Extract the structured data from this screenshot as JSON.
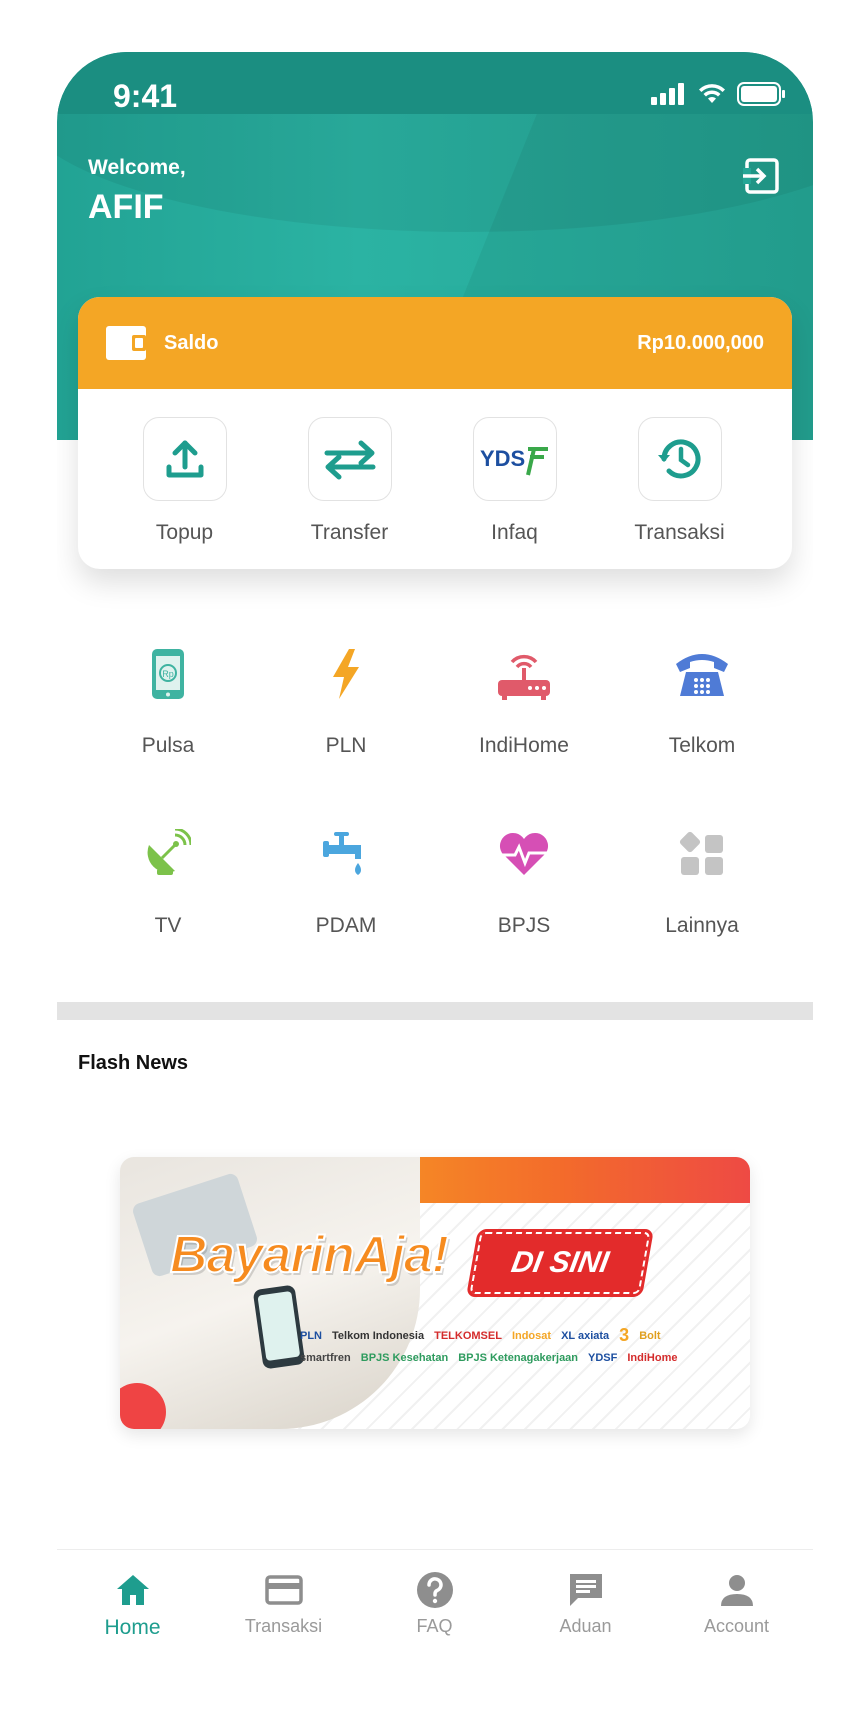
{
  "status_bar": {
    "time": "9:41"
  },
  "header": {
    "welcome": "Welcome,",
    "username": "AFIF"
  },
  "wallet": {
    "label": "Saldo",
    "amount": "Rp10.000,000"
  },
  "quick_actions": [
    {
      "label": "Topup",
      "icon": "upload-icon"
    },
    {
      "label": "Transfer",
      "icon": "transfer-arrows-icon"
    },
    {
      "label": "Infaq",
      "icon": "ydsf-logo-icon"
    },
    {
      "label": "Transaksi",
      "icon": "history-icon"
    }
  ],
  "services": [
    {
      "label": "Pulsa",
      "icon": "phone-rp-icon",
      "color": "#3fb3a1"
    },
    {
      "label": "PLN",
      "icon": "lightning-icon",
      "color": "#f4a625"
    },
    {
      "label": "IndiHome",
      "icon": "router-icon",
      "color": "#e05a6a"
    },
    {
      "label": "Telkom",
      "icon": "telephone-icon",
      "color": "#4f7bd6"
    },
    {
      "label": "TV",
      "icon": "satellite-dish-icon",
      "color": "#7cc24a"
    },
    {
      "label": "PDAM",
      "icon": "water-tap-icon",
      "color": "#4ba6de"
    },
    {
      "label": "BPJS",
      "icon": "heart-pulse-icon",
      "color": "#d64fb5"
    },
    {
      "label": "Lainnya",
      "icon": "grid-more-icon",
      "color": "#c4c4c4"
    }
  ],
  "flash_news": {
    "title": "Flash News",
    "banner": {
      "headline": "BayarinAja!",
      "badge": "DI SINI",
      "logos": [
        "PLN",
        "Telkom Indonesia",
        "TELKOMSEL",
        "Indosat",
        "XL axiata",
        "3",
        "Bolt",
        "smartfren",
        "BPJS Kesehatan",
        "BPJS Ketenagakerjaan",
        "YDSF",
        "IndiHome"
      ]
    }
  },
  "bottom_nav": [
    {
      "label": "Home",
      "icon": "home-icon",
      "active": true
    },
    {
      "label": "Transaksi",
      "icon": "card-icon",
      "active": false
    },
    {
      "label": "FAQ",
      "icon": "question-icon",
      "active": false
    },
    {
      "label": "Aduan",
      "icon": "chat-icon",
      "active": false
    },
    {
      "label": "Account",
      "icon": "person-icon",
      "active": false
    }
  ],
  "colors": {
    "primary": "#22a394",
    "accent": "#f4a625",
    "active_nav": "#1e9d8e",
    "inactive_nav": "#9a9a9a"
  }
}
